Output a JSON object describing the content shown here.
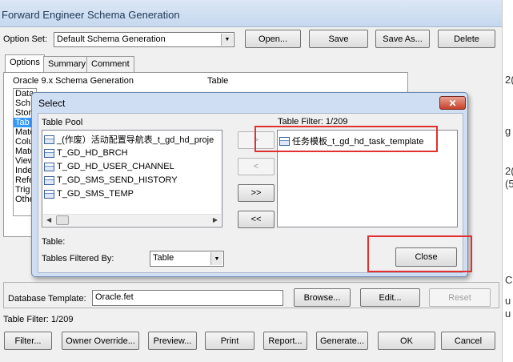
{
  "main": {
    "title": "Forward Engineer Schema Generation",
    "option_set_label": "Option Set:",
    "option_set_value": "Default Schema Generation",
    "open_label": "Open...",
    "save_label": "Save",
    "save_as_label": "Save As...",
    "delete_label": "Delete",
    "tabs": [
      {
        "label": "Options"
      },
      {
        "label": "Summary"
      },
      {
        "label": "Comment"
      }
    ],
    "oracle_header": "Oracle 9.x Schema Generation",
    "table_header": "Table",
    "object_list": [
      "Data",
      "Sch",
      "Stor",
      "Tab",
      "Mate",
      "Colu",
      "Mate",
      "View",
      "Inde",
      "Refe",
      "Trig",
      "Othe"
    ],
    "db_template_label": "Database Template:",
    "db_template_value": "Oracle.fet",
    "browse_label": "Browse...",
    "edit_label": "Edit...",
    "reset_label": "Reset",
    "table_filter_status": "Table Filter: 1/209",
    "bottom_buttons": {
      "filter": "Filter...",
      "owner_override": "Owner Override...",
      "preview": "Preview...",
      "print": "Print",
      "report": "Report...",
      "generate": "Generate...",
      "ok": "OK",
      "cancel": "Cancel"
    },
    "right_edge_glyphs": [
      "2(",
      "g",
      "2(",
      "(5",
      "C",
      "u",
      "u"
    ]
  },
  "dialog": {
    "title": "Select",
    "close_glyph": "✕",
    "table_pool_label": "Table Pool",
    "table_filter_label": "Table Filter: 1/209",
    "pool_items": [
      "_(作废）活动配置导航表_t_gd_hd_proje",
      "T_GD_HD_BRCH",
      "T_GD_HD_USER_CHANNEL",
      "T_GD_SMS_SEND_HISTORY",
      "T_GD_SMS_TEMP"
    ],
    "filter_items": [
      "任务模板_t_gd_hd_task_template"
    ],
    "move_buttons": [
      ">",
      "<",
      ">>",
      "<<"
    ],
    "table_label": "Table:",
    "tables_filtered_by_label": "Tables Filtered By:",
    "tables_filtered_by_value": "Table",
    "close_button_label": "Close"
  },
  "highlight_color": "#e03030"
}
